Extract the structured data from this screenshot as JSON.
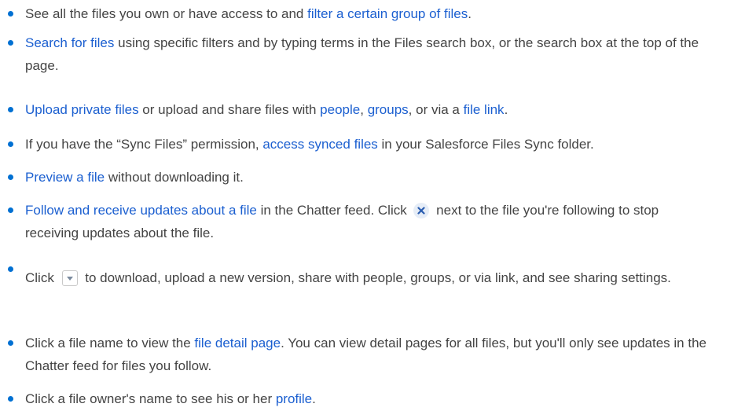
{
  "items": [
    {
      "part0": "See all the files you own or have access to and ",
      "link0": "filter a certain group of files",
      "part1": "."
    },
    {
      "link0": "Search for files",
      "part0": " using specific filters and by typing terms in the Files search box, or the search box at the top of the page."
    },
    {
      "link0": "Upload private files",
      "part0": " or upload and share files with ",
      "link1": "people",
      "part1": ", ",
      "link2": "groups",
      "part2": ", or via a ",
      "link3": "file link",
      "part3": "."
    },
    {
      "part0": "If you have the “Sync Files” permission, ",
      "link0": "access synced files",
      "part1": " in your Salesforce Files Sync folder."
    },
    {
      "link0": "Preview a file",
      "part0": " without downloading it."
    },
    {
      "link0": "Follow and receive updates about a file",
      "part0": " in the Chatter feed. Click ",
      "icon": "unfollow-x-icon",
      "part1": " next to the file you're following to stop receiving updates about the file."
    },
    {
      "part0": "Click ",
      "icon": "dropdown-menu-icon",
      "part1": " to download, upload a new version, share with people, groups, or via link, and see sharing settings."
    },
    {
      "part0": "Click a file name to view the ",
      "link0": "file detail page",
      "part1": ". You can view detail pages for all files, but you'll only see updates in the Chatter feed for files you follow."
    },
    {
      "part0": "Click a file owner's name to see his or her ",
      "link0": "profile",
      "part1": "."
    }
  ],
  "colors": {
    "bullet": "#0070d2",
    "link": "#1b5fd0",
    "text": "#444444"
  }
}
